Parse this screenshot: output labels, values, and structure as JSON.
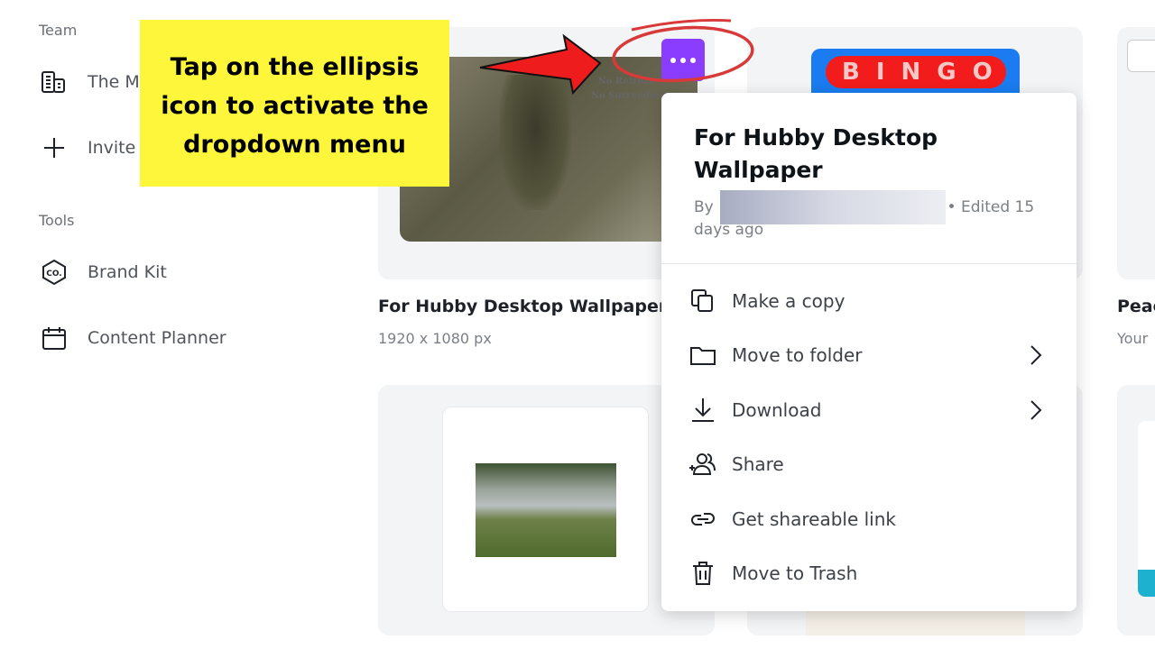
{
  "sidebar": {
    "team_heading": "Team",
    "team_items": [
      {
        "label": "The M",
        "icon": "building-icon"
      },
      {
        "label": "Invite",
        "icon": "plus-icon"
      }
    ],
    "tools_heading": "Tools",
    "tools_items": [
      {
        "label": "Brand Kit",
        "icon": "brand-kit-icon"
      },
      {
        "label": "Content Planner",
        "icon": "calendar-icon"
      }
    ]
  },
  "designs": [
    {
      "title": "For Hubby Desktop Wallpaper",
      "subtitle": "1920 x 1080 px",
      "thumb_text": [
        "No Retreat",
        "No Surrender"
      ]
    },
    {
      "title": "",
      "subtitle": "",
      "thumb_text": "BINGO"
    },
    {
      "title": "Peac",
      "subtitle": "Your"
    }
  ],
  "menu": {
    "title": "For Hubby Desktop Wallpaper",
    "by": "By",
    "edited": "• Edited 15 days ago",
    "items": [
      {
        "label": "Make a copy",
        "icon": "copy-icon"
      },
      {
        "label": "Move to folder",
        "icon": "folder-icon",
        "submenu": true
      },
      {
        "label": "Download",
        "icon": "download-icon",
        "submenu": true
      },
      {
        "label": "Share",
        "icon": "share-people-icon"
      },
      {
        "label": "Get shareable link",
        "icon": "link-icon"
      },
      {
        "label": "Move to Trash",
        "icon": "trash-icon"
      }
    ]
  },
  "annotation": {
    "text": "Tap on the ellipsis icon to activate the dropdown menu"
  },
  "colors": {
    "accent": "#8b3dff",
    "callout": "#fdf63a",
    "arrow": "#ee1c1c",
    "circle": "#d83a3a"
  }
}
